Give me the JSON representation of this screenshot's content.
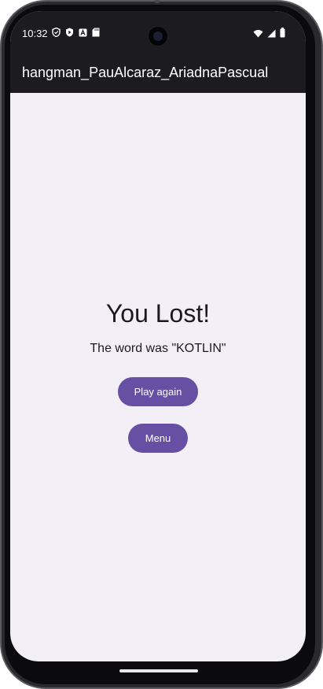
{
  "status_bar": {
    "time": "10:32",
    "icons": [
      "shield-icon",
      "play-protect-icon",
      "app-a-icon",
      "sd-card-icon"
    ],
    "right_icons": [
      "wifi-icon",
      "signal-icon",
      "battery-icon"
    ]
  },
  "app_bar": {
    "title": "hangman_PauAlcaraz_AriadnaPascual"
  },
  "result": {
    "title": "You Lost!",
    "word_message": "The word was \"KOTLIN\""
  },
  "buttons": {
    "play_again": "Play again",
    "menu": "Menu"
  },
  "colors": {
    "accent": "#6750a4",
    "bar": "#1c1b20",
    "background": "#f2f0f6"
  }
}
